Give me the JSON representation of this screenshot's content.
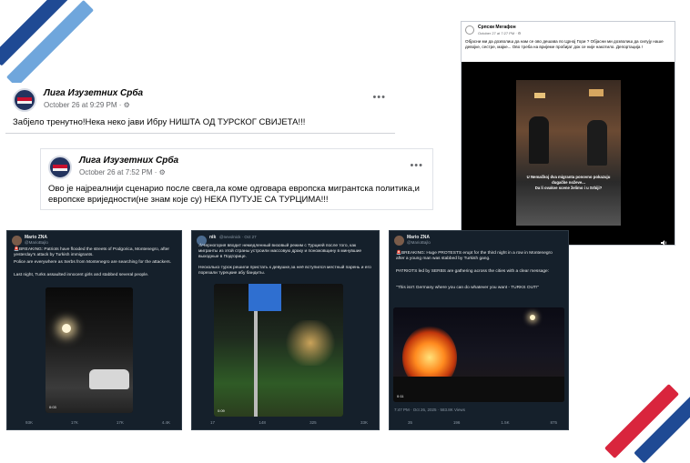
{
  "post1": {
    "author": "Лига Изузетних Срба",
    "meta": "October 26 at 9:29 PM · ⚙",
    "more": "•••",
    "text": "Забјело тренутно!Нека неко јави Ибру НИШТА ОД ТУРСКОГ СВИЈЕТА!!!"
  },
  "post2": {
    "author": "Лига Изузетних Срба",
    "meta": "October 26 at 7:52 PM · ⚙",
    "more": "•••",
    "text1": "Ово је најреалнији сценарио после свега,ла коме одговара европска мигрантска политика,и",
    "text2": "европске вриједности(не знам које су) НЕКА ПУТУЈЕ СА ТУРЦИМА!!!"
  },
  "megafon": {
    "author": "Српски Мегафон",
    "meta": "October 27 at 7:27 PM · ⚙",
    "text": "Објасни ми да дозволиш да нам се ово дешава по Црној Гори ? Објасни ми дозволиш да силују наше девојке, сестре, мајке... Ово треба на вријеме пробијат док се није накотило. Депортација !",
    "caption1": "U Nemačkoj dva migranta ponovno pokazuju",
    "caption2": "dugačke noževe...",
    "caption3": "Da li ovakve scene želimo i u Srbiji?",
    "volume_icon": "speaker-icon"
  },
  "tweet1": {
    "name": "Mario ZNA",
    "handle": "@MarioBajlo",
    "p1": "🚨BREAKING: Patriots have flooded the streets of Podgorica, Montenegro, after yesterday's attack by Turkish immigrants.",
    "p2": "Police are everywhere as Serbs from Montenegro are searching for the attackers.",
    "p3": "Last night, Turks assaulted innocent girls and stabbed several people.",
    "duration": "0:03",
    "a1": "93K",
    "a2": "17K",
    "a3": "17K",
    "a4": "4.4K"
  },
  "tweet2": {
    "name": "nik",
    "handle": "@nevolnick · Oct 27",
    "p1": "⚠Черногория вводит немедленный визовый режим с Турцией после того, как мигранты из этой страны устроили массовую драку и поножовщину в минувшие выходные в Подгорице.",
    "p2": "Несколько турок решили пристать к девушке,за неё вступился местный парень и его порезали турецкие абу бандиты.",
    "duration": "0:09",
    "a1": "17",
    "a2": "148",
    "a3": "325",
    "a4": "33K"
  },
  "tweet3": {
    "name": "Mario ZNA",
    "handle": "@MarioBajlo",
    "p1": "🚨BREAKING: Huge PROTESTS erupt for the third night in a row in Montenegro after a young man was stabbed by Turkish gang.",
    "p2": "PATRIOTS led by SERBS are gathering across the cities with a clear message:",
    "p3": "\"This isn't Germany where you can do whatever you want - TURKS OUT!\"",
    "duration": "0:11",
    "footer": "7:47 PM · Oct 26, 2025 · 583.8K Views",
    "a1": "35",
    "a2": "196",
    "a3": "1.5K",
    "a4": "875"
  }
}
